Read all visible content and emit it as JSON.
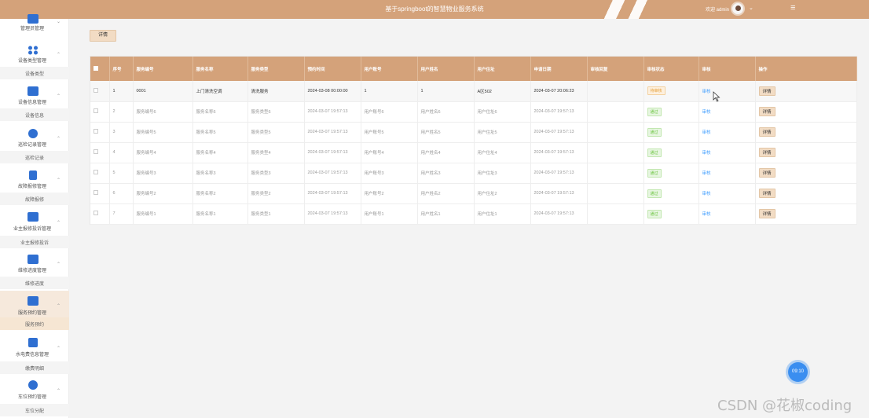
{
  "header": {
    "title": "基于springboot的智慧物业服务系统",
    "user_text": "欢迎 admin",
    "caret": "⌄",
    "menu_icon": "≡"
  },
  "sidebar": {
    "groups": [
      {
        "label": "管理员管理",
        "icon": "users-icon",
        "chevron": "⌄",
        "sub": ""
      },
      {
        "label": "设备类型管理",
        "icon": "grid-icon",
        "chevron": "⌃",
        "sub": "设备类型"
      },
      {
        "label": "设备信息管理",
        "icon": "briefcase-icon",
        "chevron": "⌃",
        "sub": "设备信息"
      },
      {
        "label": "巡检记录管理",
        "icon": "circle-icon",
        "chevron": "⌃",
        "sub": "巡检记录"
      },
      {
        "label": "故障报修管理",
        "icon": "clipboard-icon",
        "chevron": "⌃",
        "sub": "故障报修"
      },
      {
        "label": "业主报修投诉管理",
        "icon": "folder-icon",
        "chevron": "⌃",
        "sub": "业主报修投诉"
      },
      {
        "label": "维修进度管理",
        "icon": "image-icon",
        "chevron": "⌃",
        "sub": "维修进度"
      },
      {
        "label": "服务预约管理",
        "icon": "service-icon",
        "chevron": "⌃",
        "sub": "服务预约"
      },
      {
        "label": "水电费信息管理",
        "icon": "cabinet-icon",
        "chevron": "⌃",
        "sub": "缴费明细"
      },
      {
        "label": "车位预约管理",
        "icon": "compass-icon",
        "chevron": "⌃",
        "sub": "车位分配"
      }
    ]
  },
  "toolbar": {
    "detail_label": "详情"
  },
  "table": {
    "columns": [
      "序号",
      "服务编号",
      "服务名称",
      "服务类型",
      "预约时间",
      "用户账号",
      "用户姓名",
      "用户住址",
      "申请日期",
      "审核回复",
      "审核状态",
      "审核",
      "操作"
    ],
    "rows": [
      {
        "seq": "1",
        "code": "0001",
        "name": "上门清洗空调",
        "type": "清洗服务",
        "time": "2024-03-08 00:00:00",
        "account": "1",
        "uname": "1",
        "address": "A区502",
        "date": "2024-03-07 20:06:23",
        "reply": "",
        "status": "待审核",
        "audit": "审核",
        "op": "详情"
      },
      {
        "seq": "2",
        "code": "服务编号6",
        "name": "服务名称6",
        "type": "服务类型6",
        "time": "2024-03-07 19:57:13",
        "account": "用户账号6",
        "uname": "用户姓名6",
        "address": "用户住址6",
        "date": "2024-03-07 19:57:13",
        "reply": "",
        "status": "通过",
        "audit": "审核",
        "op": "详情"
      },
      {
        "seq": "3",
        "code": "服务编号5",
        "name": "服务名称5",
        "type": "服务类型5",
        "time": "2024-03-07 19:57:13",
        "account": "用户账号5",
        "uname": "用户姓名5",
        "address": "用户住址5",
        "date": "2024-03-07 19:57:13",
        "reply": "",
        "status": "通过",
        "audit": "审核",
        "op": "详情"
      },
      {
        "seq": "4",
        "code": "服务编号4",
        "name": "服务名称4",
        "type": "服务类型4",
        "time": "2024-03-07 19:57:13",
        "account": "用户账号4",
        "uname": "用户姓名4",
        "address": "用户住址4",
        "date": "2024-03-07 19:57:13",
        "reply": "",
        "status": "通过",
        "audit": "审核",
        "op": "详情"
      },
      {
        "seq": "5",
        "code": "服务编号3",
        "name": "服务名称3",
        "type": "服务类型3",
        "time": "2024-03-07 19:57:13",
        "account": "用户账号3",
        "uname": "用户姓名3",
        "address": "用户住址3",
        "date": "2024-03-07 19:57:13",
        "reply": "",
        "status": "通过",
        "audit": "审核",
        "op": "详情"
      },
      {
        "seq": "6",
        "code": "服务编号2",
        "name": "服务名称2",
        "type": "服务类型2",
        "time": "2024-03-07 19:57:13",
        "account": "用户账号2",
        "uname": "用户姓名2",
        "address": "用户住址2",
        "date": "2024-03-07 19:57:13",
        "reply": "",
        "status": "通过",
        "audit": "审核",
        "op": "详情"
      },
      {
        "seq": "7",
        "code": "服务编号1",
        "name": "服务名称1",
        "type": "服务类型1",
        "time": "2024-03-07 19:57:13",
        "account": "用户账号1",
        "uname": "用户姓名1",
        "address": "用户住址1",
        "date": "2024-03-07 19:57:13",
        "reply": "",
        "status": "通过",
        "audit": "审核",
        "op": "详情"
      }
    ]
  },
  "float_button": {
    "label": "09:10"
  },
  "watermark": "CSDN @花椒coding",
  "colors": {
    "header": "#d4a27a",
    "accent_icon": "#2f6fd1",
    "link": "#409eff"
  }
}
